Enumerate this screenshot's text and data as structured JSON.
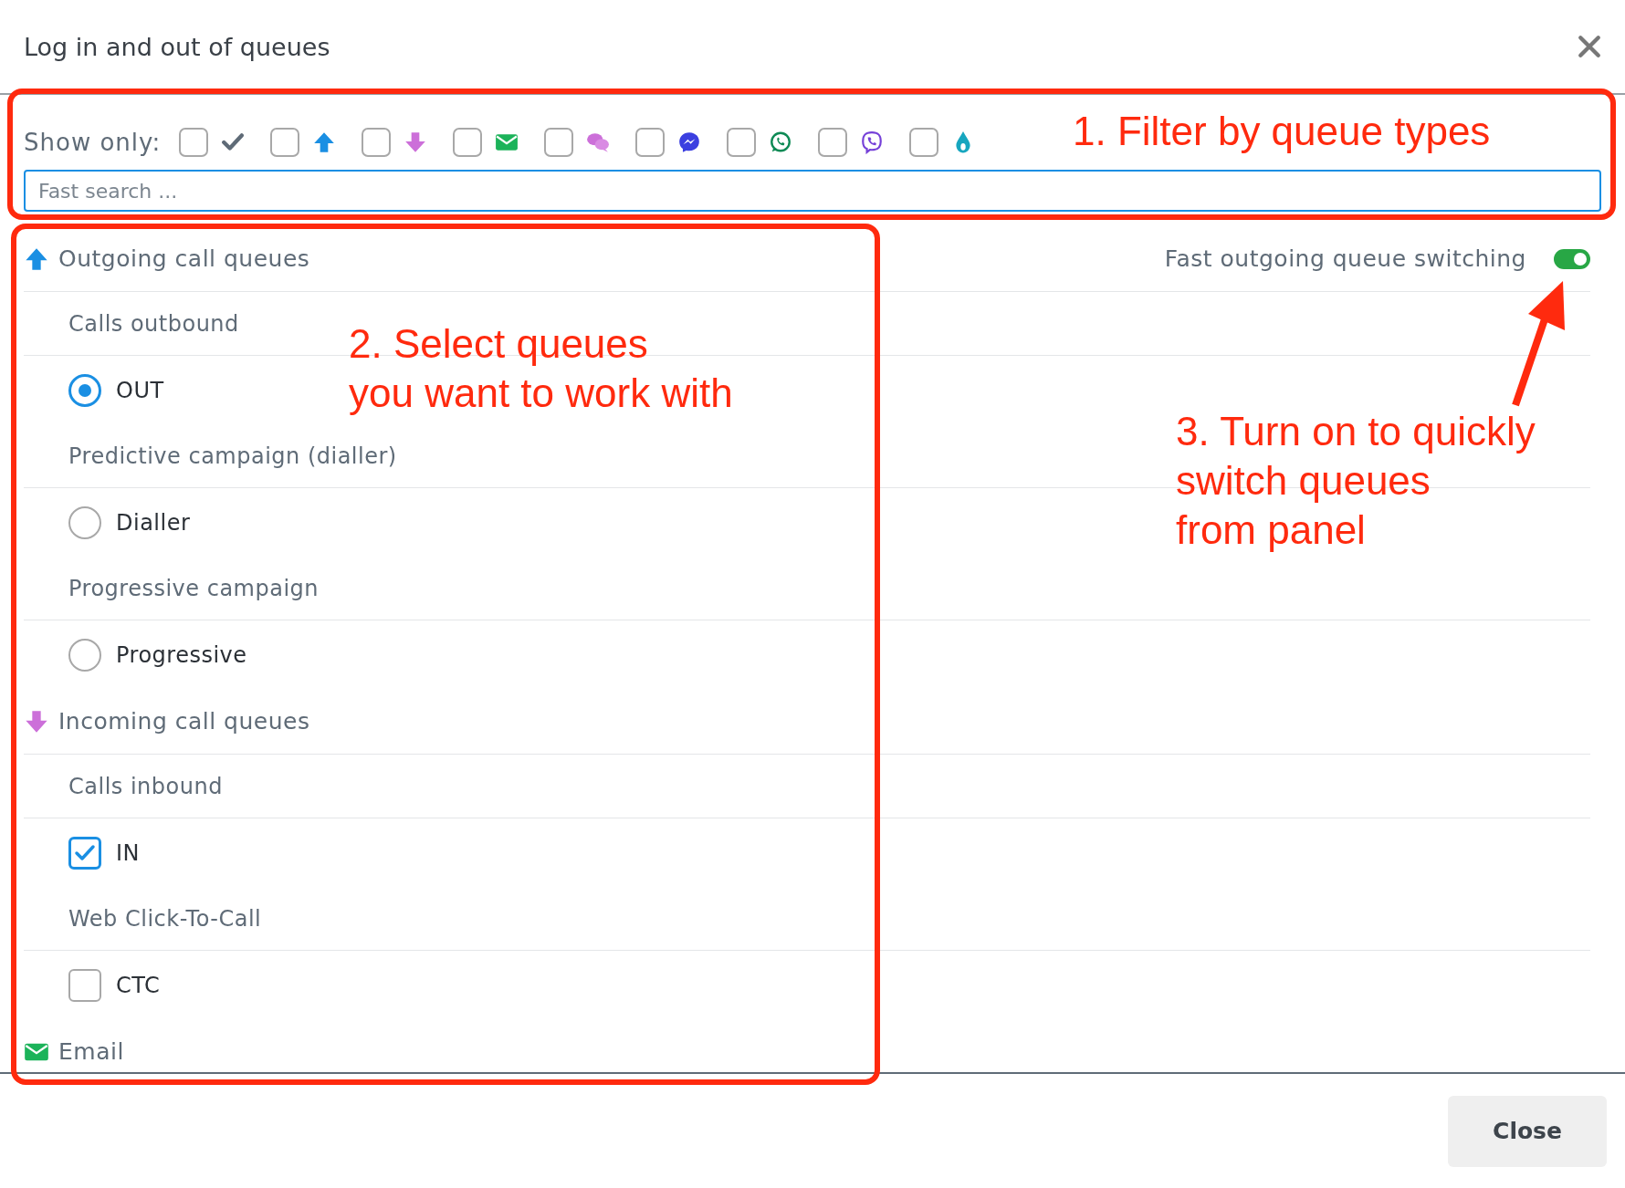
{
  "dialog": {
    "title": "Log in and out of queues"
  },
  "filter": {
    "label": "Show only:",
    "types": [
      {
        "kind": "done",
        "checked": false
      },
      {
        "kind": "outgoing",
        "checked": false
      },
      {
        "kind": "incoming",
        "checked": false
      },
      {
        "kind": "email",
        "checked": false
      },
      {
        "kind": "chat",
        "checked": false
      },
      {
        "kind": "messenger",
        "checked": false
      },
      {
        "kind": "whatsapp",
        "checked": false
      },
      {
        "kind": "viber",
        "checked": false
      },
      {
        "kind": "drop",
        "checked": false
      }
    ]
  },
  "search": {
    "placeholder": "Fast search ..."
  },
  "groups": [
    {
      "kind": "outgoing",
      "title": "Outgoing call queues",
      "switch": {
        "label": "Fast outgoing queue switching",
        "on": true
      },
      "sections": [
        {
          "title": "Calls outbound",
          "queues": [
            {
              "kind": "radio",
              "name": "OUT",
              "selected": true
            }
          ]
        },
        {
          "title": "Predictive campaign (dialler)",
          "queues": [
            {
              "kind": "radio",
              "name": "Dialler",
              "selected": false
            }
          ]
        },
        {
          "title": "Progressive campaign",
          "queues": [
            {
              "kind": "radio",
              "name": "Progressive",
              "selected": false
            }
          ]
        }
      ]
    },
    {
      "kind": "incoming",
      "title": "Incoming call queues",
      "sections": [
        {
          "title": "Calls inbound",
          "queues": [
            {
              "kind": "checkbox",
              "name": "IN",
              "checked": true
            }
          ]
        },
        {
          "title": "Web Click-To-Call",
          "queues": [
            {
              "kind": "checkbox",
              "name": "CTC",
              "checked": false
            }
          ]
        }
      ]
    },
    {
      "kind": "email",
      "title": "Email"
    }
  ],
  "annotations": [
    {
      "lines": [
        "1. Filter by queue types"
      ]
    },
    {
      "lines": [
        "2. Select queues",
        "you want to work with"
      ]
    },
    {
      "lines": [
        "3. Turn on to quickly",
        "switch queues",
        "from panel"
      ]
    }
  ],
  "buttons": [
    "Close"
  ]
}
